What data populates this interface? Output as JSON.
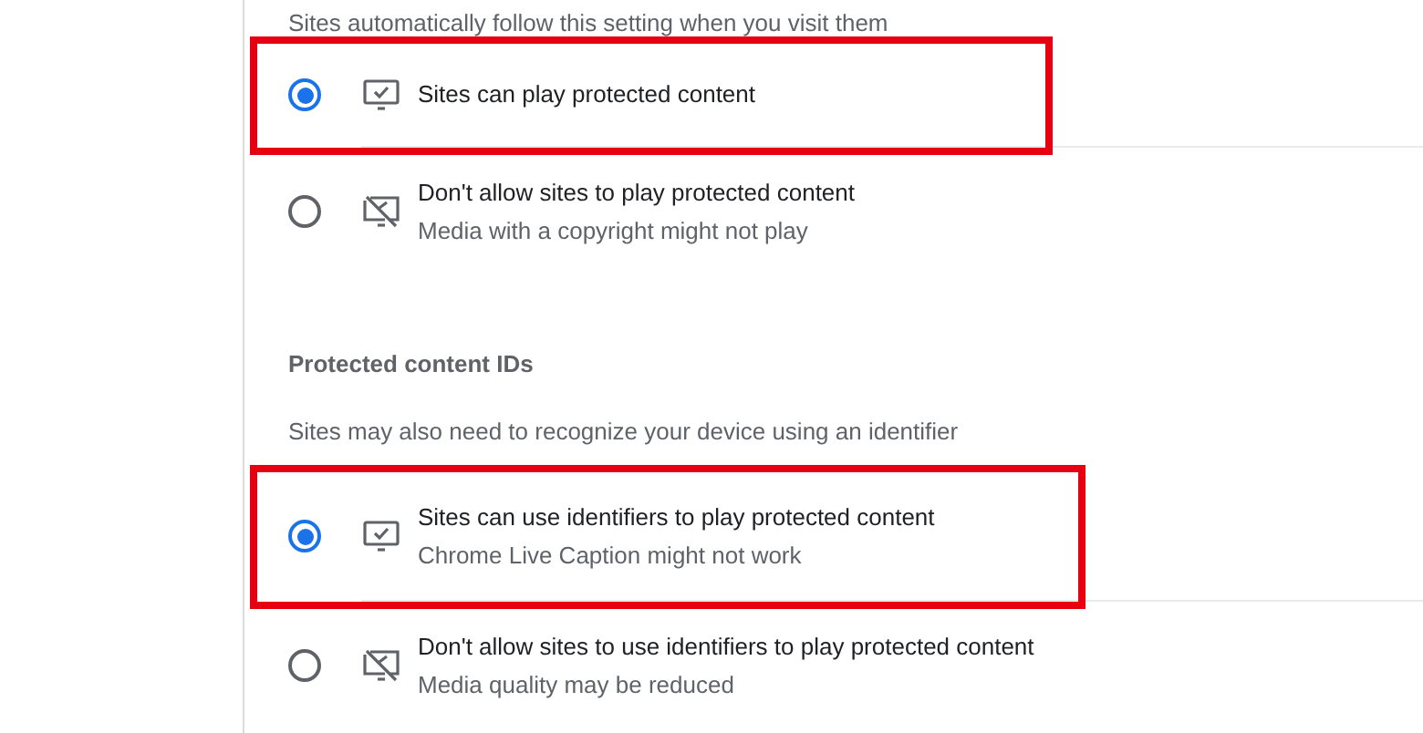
{
  "sections": [
    {
      "description": "Sites automatically follow this setting when you visit them",
      "options": [
        {
          "kind": "allow",
          "label": "Sites can play protected content",
          "selected": true,
          "highlighted": true
        },
        {
          "kind": "block",
          "label": "Don't allow sites to play protected content",
          "sublabel": "Media with a copyright might not play",
          "selected": false,
          "highlighted": false
        }
      ]
    },
    {
      "heading": "Protected content IDs",
      "description": "Sites may also need to recognize your device using an identifier",
      "options": [
        {
          "kind": "allow",
          "label": "Sites can use identifiers to play protected content",
          "sublabel": "Chrome Live Caption might not work",
          "selected": true,
          "highlighted": true
        },
        {
          "kind": "block",
          "label": "Don't allow sites to use identifiers to play protected content",
          "sublabel": "Media quality may be reduced",
          "selected": false,
          "highlighted": false
        }
      ]
    }
  ]
}
